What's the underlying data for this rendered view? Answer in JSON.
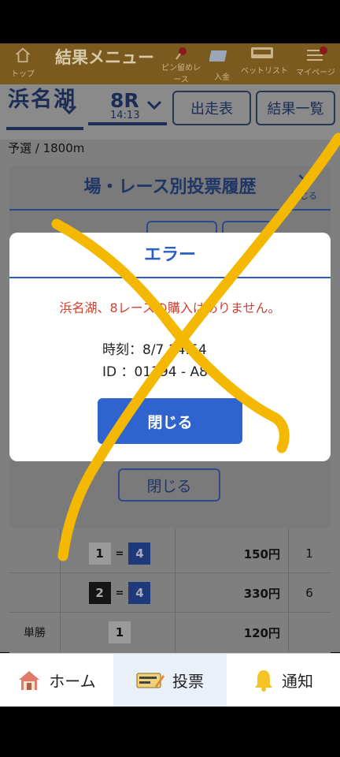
{
  "header": {
    "title": "結果メニュー",
    "items": [
      {
        "label": "トップ",
        "icon": "home-icon"
      },
      {
        "label": "ピン留めレース",
        "icon": "pin-icon"
      },
      {
        "label": "入金",
        "icon": "deposit-icon"
      },
      {
        "label": "ベットリスト",
        "icon": "betlist-icon"
      },
      {
        "label": "マイページ",
        "icon": "mypage-icon"
      }
    ]
  },
  "race": {
    "venue": "浜名湖",
    "race_no": "8R",
    "race_time": "14:13",
    "btn_entries": "出走表",
    "btn_results": "結果一覧",
    "info": "予選 / 1800m"
  },
  "bg_modal": {
    "title": "場・レース別投票履歴",
    "close_label": "閉じる",
    "close_button": "閉じる"
  },
  "table": {
    "rows": [
      {
        "label": "",
        "combo": [
          "1",
          "4"
        ],
        "sep": "=",
        "amount": "150円",
        "rank": "1"
      },
      {
        "label": "",
        "combo": [
          "2",
          "4"
        ],
        "sep": "=",
        "amount": "330円",
        "rank": "6"
      },
      {
        "label": "単勝",
        "combo": [
          "1"
        ],
        "sep": "",
        "amount": "120円",
        "rank": ""
      }
    ]
  },
  "modal": {
    "title": "エラー",
    "message": "浜名湖、8レースの購入はありません。",
    "time_line": "時刻：8/7 14:54",
    "id_line": "ID ：01394 - A8",
    "button": "閉じる"
  },
  "bottom_nav": {
    "items": [
      {
        "label": "ホーム",
        "icon": "house-icon"
      },
      {
        "label": "投票",
        "icon": "ticket-icon"
      },
      {
        "label": "通知",
        "icon": "bell-icon"
      }
    ]
  },
  "colors": {
    "accent": "#2f64cf",
    "error_text": "#d0402f",
    "scribble": "#f5b800"
  }
}
